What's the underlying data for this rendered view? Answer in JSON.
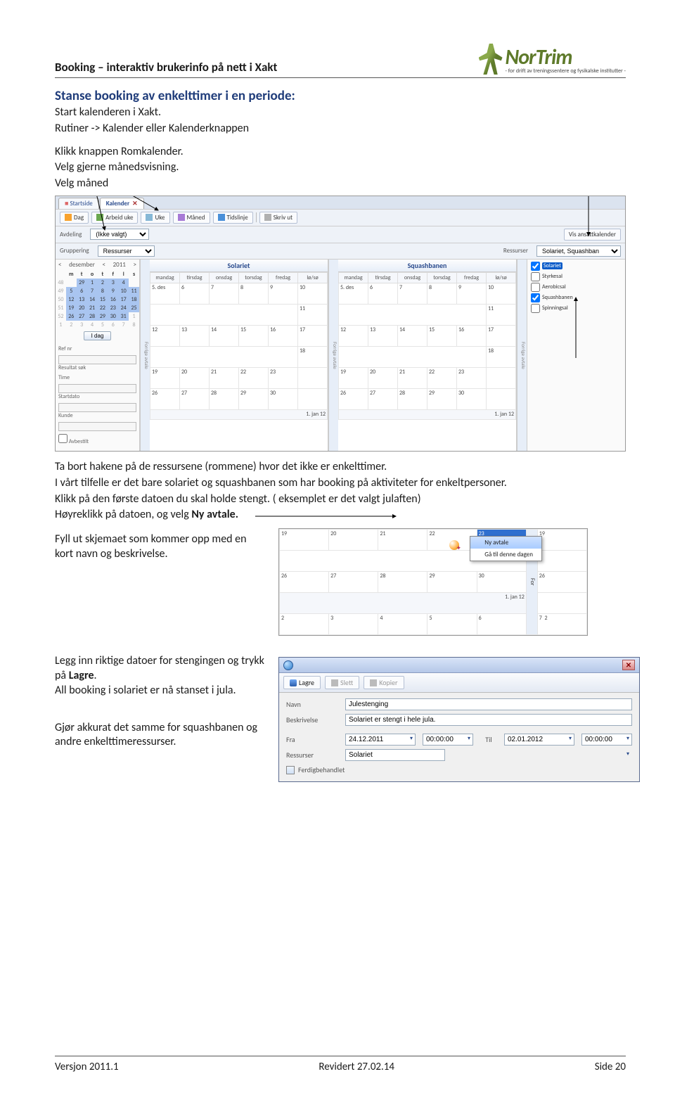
{
  "header": {
    "title": "Booking – interaktiv brukerinfo på nett i Xakt",
    "logo_text": "NorTrim",
    "logo_sub": "- for drift av treningssentere og fysikalske institutter -"
  },
  "section_title": "Stanse booking av enkelttimer i en periode:",
  "intro": {
    "l1": "Start kalenderen i Xakt.",
    "l2": "Rutiner -> Kalender eller Kalenderknappen",
    "l3": "Klikk knappen Romkalender.",
    "l4": "Velg gjerne månedsvisning.",
    "l5": "Velg måned"
  },
  "app": {
    "tabs": {
      "startside": "Startside",
      "kalender": "Kalender"
    },
    "toolbar": {
      "dag": "Dag",
      "arbeid_uke": "Arbeid uke",
      "uke": "Uke",
      "maned": "Måned",
      "tidslinje": "Tidslinje",
      "skriv_ut": "Skriv ut"
    },
    "filters": {
      "avdeling_label": "Avdeling",
      "avdeling_value": "(Ikke valgt)",
      "gruppering_label": "Gruppering",
      "gruppering_value": "Ressurser"
    },
    "right": {
      "ansatt_btn": "Vis ansattkalender",
      "ressurser_label": "Ressurser",
      "ressurser_value": "Solariet, Squashbanen",
      "items": [
        "Solariet",
        "Styrkesal",
        "Aerobicsal",
        "Squashbanen",
        "Spinningsal"
      ]
    },
    "mini_cal": {
      "prev": "<",
      "month": "desember",
      "next_prev": "<",
      "year": "2011",
      "next": ">",
      "dow": [
        "m",
        "t",
        "o",
        "t",
        "f",
        "l",
        "s"
      ],
      "weeks": [
        {
          "wk": "48",
          "d": [
            "",
            "29",
            "1",
            "2",
            "3",
            "4"
          ]
        },
        {
          "wk": "49",
          "d": [
            "5",
            "6",
            "7",
            "8",
            "9",
            "10",
            "11"
          ]
        },
        {
          "wk": "50",
          "d": [
            "12",
            "13",
            "14",
            "15",
            "16",
            "17",
            "18"
          ]
        },
        {
          "wk": "51",
          "d": [
            "19",
            "20",
            "21",
            "22",
            "23",
            "24",
            "25"
          ]
        },
        {
          "wk": "52",
          "d": [
            "26",
            "27",
            "28",
            "29",
            "30",
            "31",
            "1"
          ]
        },
        {
          "wk": "1",
          "d": [
            "2",
            "3",
            "4",
            "5",
            "6",
            "7",
            "8"
          ]
        }
      ],
      "idag": "I dag"
    },
    "search": {
      "refnr": "Ref nr",
      "resultat": "Resultat søk",
      "time": "Time",
      "startdato": "Startdato",
      "kunde": "Kunde",
      "avbestilt": "Avbestilt"
    },
    "calendars": {
      "a_title": "Solariet",
      "b_title": "Squashbanen",
      "dow": [
        "mandag",
        "tirsdag",
        "onsdag",
        "torsdag",
        "fredag",
        "lø/sø"
      ],
      "rows": [
        [
          "5. des",
          "6",
          "7",
          "8",
          "9",
          "10"
        ],
        [
          "",
          "",
          "",
          "",
          "",
          "11"
        ],
        [
          "12",
          "13",
          "14",
          "15",
          "16",
          "17"
        ],
        [
          "",
          "",
          "",
          "",
          "",
          "18"
        ],
        [
          "19",
          "20",
          "21",
          "22",
          "23",
          ""
        ],
        [
          "26",
          "27",
          "28",
          "29",
          "30",
          ""
        ]
      ],
      "foot_a": "1. jan 12",
      "foot_b": "1. jan 12",
      "sidetab": "Forrige avtale"
    }
  },
  "mid_para": {
    "p1": "Ta bort hakene på de ressursene (rommene) hvor det ikke er enkelttimer.",
    "p2": "I vårt tilfelle er det bare solariet og squashbanen som har booking på aktiviteter for enkeltpersoner.",
    "p3": "Klikk på den første datoen du skal holde stengt. ( eksemplet er det valgt julaften)",
    "p4a": "Høyreklikk på datoen, og velg ",
    "p4b": "Ny avtale."
  },
  "ctx": {
    "head_a": [
      "19",
      "20",
      "21",
      "22",
      "23"
    ],
    "head_b": "19",
    "row2_a": [
      "26",
      "27",
      "28",
      "29",
      "30"
    ],
    "row2_b": "26",
    "foot_a": "1. jan 12",
    "row3_a": [
      "2",
      "3",
      "4",
      "5",
      "6"
    ],
    "row3_b_nums": [
      "7",
      "2"
    ],
    "menu_new": "Ny avtale",
    "menu_goto": "Gå til denne dagen",
    "sidetab": "For"
  },
  "fill_form": "Fyll ut skjemaet som kommer opp med en kort  navn og beskrivelse.",
  "dates_para": {
    "l1": "Legg inn riktige datoer for stengingen og trykk på ",
    "l1b": "Lagre",
    "l2": "All booking i solariet er nå stanset i jula."
  },
  "repeat_para": "Gjør akkurat det samme for squashbanen og andre enkelttimeressurser.",
  "dialog": {
    "toolbar": {
      "lagre": "Lagre",
      "slett": "Slett",
      "kopier": "Kopier"
    },
    "labels": {
      "navn": "Navn",
      "beskrivelse": "Beskrivelse",
      "fra": "Fra",
      "til": "Til",
      "ressurser": "Ressurser",
      "ferdig": "Ferdigbehandlet"
    },
    "values": {
      "navn": "Julestenging",
      "beskrivelse": "Solariet er stengt i hele jula.",
      "fra_dato": "24.12.2011",
      "fra_tid": "00:00:00",
      "til_dato": "02.01.2012",
      "til_tid": "00:00:00",
      "ressurser": "Solariet"
    }
  },
  "footer": {
    "left": "Versjon 2011.1",
    "center": "Revidert 27.02.14",
    "right": "Side 20"
  }
}
